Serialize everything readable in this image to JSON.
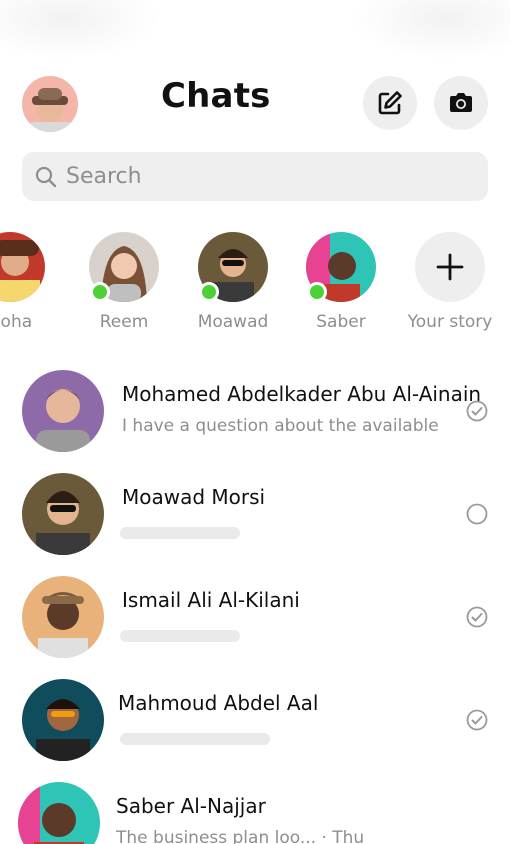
{
  "header": {
    "title": "Chats"
  },
  "search": {
    "placeholder": "Search"
  },
  "stories": [
    {
      "label": "Noha",
      "online": false
    },
    {
      "label": "Reem",
      "online": true
    },
    {
      "label": "Moawad",
      "online": true
    },
    {
      "label": "Saber",
      "online": true
    },
    {
      "label": "Your story",
      "add": true
    }
  ],
  "chats": [
    {
      "name": "Mohamed Abdelkader Abu Al-Ainain",
      "preview": "I have a question about the available wat",
      "status": "sent-check-icon"
    },
    {
      "name": "Moawad Morsi",
      "preview": "",
      "status": "unsent-circle-icon"
    },
    {
      "name": "Ismail Ali Al-Kilani",
      "preview": "",
      "status": "sent-check-icon"
    },
    {
      "name": "Mahmoud Abdel Aal",
      "preview": "",
      "status": "sent-check-icon"
    },
    {
      "name": "Saber Al-Najjar",
      "preview": "The business plan loo... · Thu",
      "status": ""
    }
  ],
  "colors": {
    "online": "#4cd137",
    "muted_text": "#8e8e8e",
    "button_bg": "#eeeeee"
  }
}
